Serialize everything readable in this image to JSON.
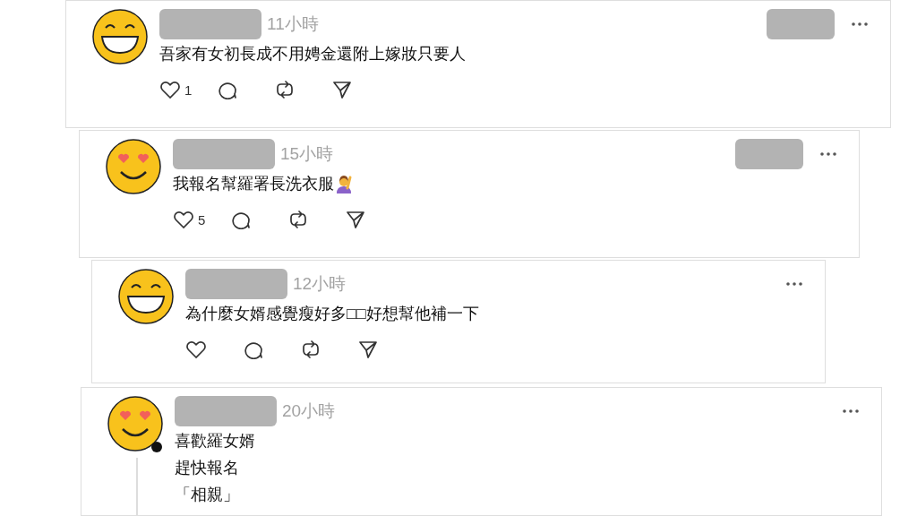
{
  "comments": [
    {
      "avatar": {
        "kind": "grin",
        "dot": false
      },
      "time": "11小時",
      "side_box": true,
      "lines": [
        "吾家有女初長成不用娉金還附上嫁妝只要人"
      ],
      "hand_emoji": false,
      "actions_shown": true,
      "likes": "1",
      "thread_line": false
    },
    {
      "avatar": {
        "kind": "heart_eyes",
        "dot": false
      },
      "time": "15小時",
      "side_box": true,
      "lines": [
        "我報名幫羅署長洗衣服"
      ],
      "hand_emoji": true,
      "actions_shown": true,
      "likes": "5",
      "thread_line": false
    },
    {
      "avatar": {
        "kind": "grin",
        "dot": false
      },
      "time": "12小時",
      "side_box": false,
      "lines": [
        "為什麼女婿感覺瘦好多□□好想幫他補一下"
      ],
      "hand_emoji": false,
      "actions_shown": true,
      "thread_line": false
    },
    {
      "avatar": {
        "kind": "heart_eyes",
        "dot": true
      },
      "time": "20小時",
      "side_box": false,
      "lines": [
        "喜歡羅女婿",
        "趕快報名",
        "「相親」"
      ],
      "hand_emoji": false,
      "actions_shown": false,
      "thread_line": true
    }
  ]
}
